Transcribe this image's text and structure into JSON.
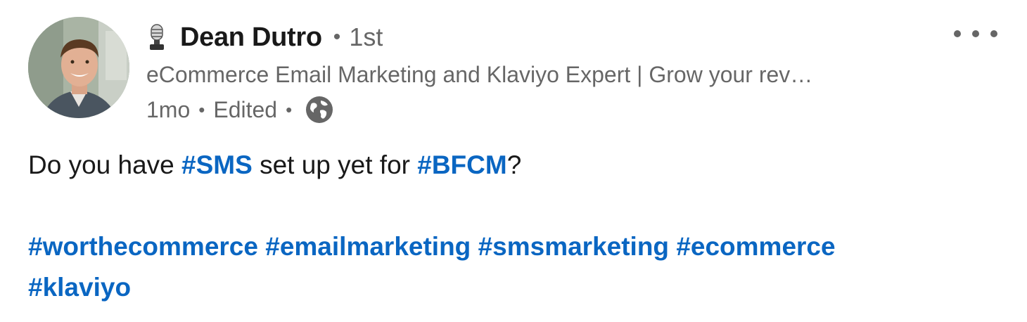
{
  "author": {
    "name": "Dean Dutro",
    "degree": "1st",
    "headline": "eCommerce Email Marketing and Klaviyo Expert | Grow your rev…",
    "icon": "microphone-icon"
  },
  "meta": {
    "time": "1mo",
    "edited": "Edited",
    "visibility_icon": "globe-icon",
    "separator": "•"
  },
  "post": {
    "line1": {
      "text_before": "Do you have ",
      "tag1": "#SMS",
      "text_middle": " set up yet for ",
      "tag2": "#BFCM",
      "text_after": "?"
    },
    "hashtags": [
      "#worthecommerce",
      "#emailmarketing",
      "#smsmarketing",
      "#ecommerce",
      "#klaviyo"
    ]
  },
  "actions": {
    "more_icon": "more-horizontal-icon"
  },
  "colors": {
    "link": "#0a66c2",
    "text_primary": "#191919",
    "text_secondary": "#666666"
  }
}
